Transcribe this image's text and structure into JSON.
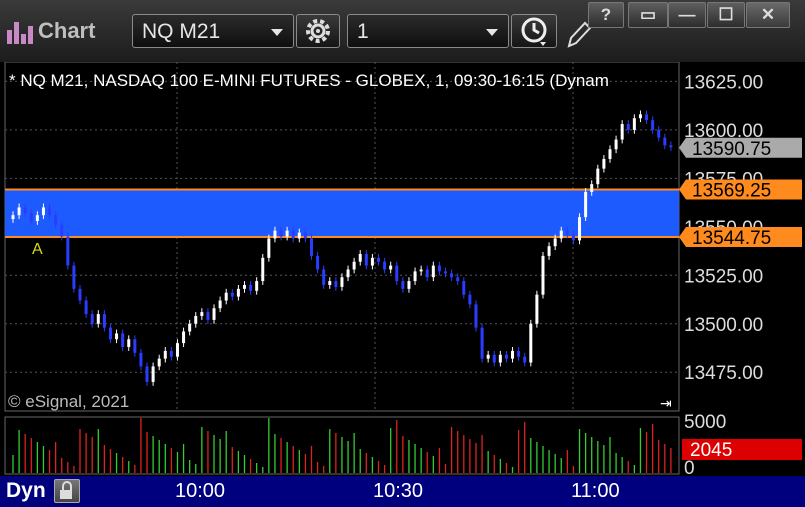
{
  "window": {
    "title": "Chart",
    "symbol": "NQ M21",
    "interval": "1",
    "buttons": [
      "?",
      "▭",
      "—",
      "☐",
      "✕"
    ]
  },
  "chart_data": {
    "type": "candlestick",
    "title": "* NQ M21, NASDAQ 100 E-MINI FUTURES - GLOBEX, 1, 09:30-16:15 (Dynam",
    "watermark": "© eSignal, 2021",
    "price_ticks": [
      "13625.00",
      "13600.00",
      "13575.00",
      "13550.00",
      "13525.00",
      "13500.00",
      "13475.00"
    ],
    "ylim": [
      13455,
      13635
    ],
    "last_price": "13590.75",
    "zone": {
      "upper": 13569.25,
      "lower": 13544.75,
      "upper_label": "13569.25",
      "lower_label": "13544.75"
    },
    "annotation": "A",
    "closes": [
      13556,
      13560,
      13557,
      13553,
      13556,
      13560,
      13556,
      13551,
      13545,
      13530,
      13518,
      13512,
      13505,
      13500,
      13505,
      13498,
      13492,
      13495,
      13488,
      13492,
      13485,
      13478,
      13470,
      13478,
      13482,
      13486,
      13483,
      13490,
      13496,
      13500,
      13504,
      13506,
      13502,
      13508,
      13512,
      13516,
      13514,
      13518,
      13520,
      13517,
      13522,
      13534,
      13544,
      13548,
      13545,
      13548,
      13544,
      13547,
      13544,
      13535,
      13528,
      13520,
      13522,
      13519,
      13524,
      13528,
      13532,
      13536,
      13530,
      13534,
      13532,
      13528,
      13530,
      13522,
      13518,
      13522,
      13527,
      13528,
      13524,
      13530,
      13527,
      13526,
      13524,
      13522,
      13515,
      13510,
      13498,
      13482,
      13484,
      13480,
      13484,
      13482,
      13486,
      13483,
      13480,
      13500,
      13515,
      13535,
      13540,
      13544,
      13548,
      13546,
      13543,
      13555,
      13568,
      13572,
      13580,
      13585,
      13590,
      13595,
      13603,
      13600,
      13606,
      13608,
      13605,
      13600,
      13596,
      13592,
      13591
    ],
    "volume": {
      "axis_max": "5000",
      "axis_min": "0",
      "last": "2045",
      "colors": [
        "#dd2222",
        "#33cc33"
      ]
    },
    "time_labels": [
      "10:00",
      "10:30",
      "11:00"
    ],
    "colors": {
      "up": "#ffffff",
      "down": "#2a3cff",
      "zone": "#1e5bff",
      "zone_line": "#ff8a1e",
      "last_badge": "#aaaaaa",
      "vol_badge": "#dd0000"
    }
  },
  "statusbar": {
    "label": "Dyn"
  }
}
